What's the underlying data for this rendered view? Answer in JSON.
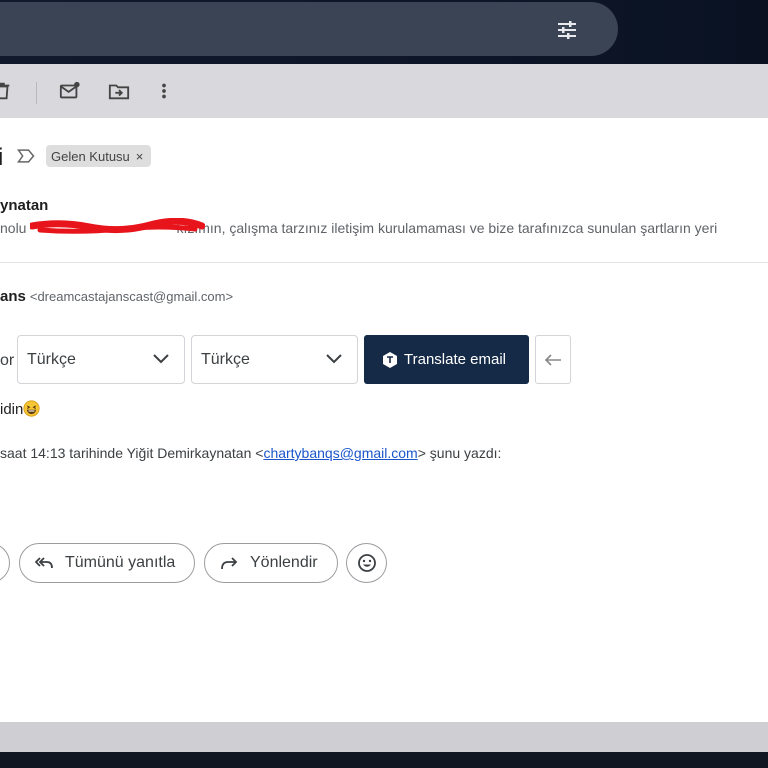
{
  "search": {
    "value": ""
  },
  "toolbar": {
    "icons": [
      "delete-icon",
      "mark-unread-icon",
      "move-to-icon",
      "more-vert-icon"
    ]
  },
  "message": {
    "subject_tail": "i",
    "label": {
      "name": "Gelen Kutusu",
      "remove": "×"
    },
    "sender_partial": "ynatan",
    "snippet_start": "nolu",
    "snippet_end": "kızımın, çalışma tarzınız iletişim kurulamaması ve bize tarafınızca sunulan şartların yeri",
    "from_name_partial": "ans",
    "from_email": "<dreamcastajanscast@gmail.com>"
  },
  "translate": {
    "lead_text": "or",
    "source_lang": "Türkçe",
    "target_lang": "Türkçe",
    "button_label": "Translate email",
    "back_icon": "arrow-left-icon"
  },
  "body": {
    "line1": "idin",
    "emoji": "grinning-squinting-emoji",
    "quote_prefix": "saat 14:13 tarihinde Yiğit Demirkaynatan <",
    "quote_email": "chartybanqs@gmail.com",
    "quote_suffix": "> şunu yazdı:"
  },
  "actions": {
    "reply_all": "Tümünü yanıtla",
    "forward": "Yönlendir"
  },
  "colors": {
    "translate_button": "#152a46",
    "link": "#1a56c9",
    "redaction": "#e8141b"
  }
}
